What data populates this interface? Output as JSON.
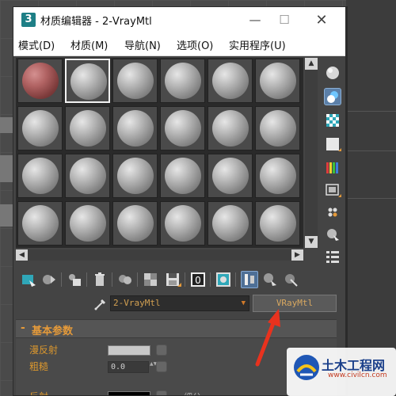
{
  "window": {
    "app_icon_glyph": "3",
    "title": "材质编辑器 - 2-VrayMtl",
    "controls": {
      "minimize": "—",
      "maximize": "☐",
      "close": "✕"
    }
  },
  "menu": [
    "模式(D)",
    "材质(M)",
    "导航(N)",
    "选项(O)",
    "实用程序(U)"
  ],
  "sample_slots": {
    "rows": 4,
    "columns": 6,
    "selected_slot": 2,
    "red_slot": 1
  },
  "scroll_glyphs": {
    "up": "▲",
    "down": "▼",
    "left": "◀",
    "right": "▶"
  },
  "material": {
    "name": "2-VrayMtl",
    "type_button": "VRayMtl"
  },
  "rollout": {
    "collapse_glyph": "-",
    "title": "基本参数",
    "diffuse_label": "漫反射",
    "roughness_label": "粗糙",
    "roughness_value": "0.0",
    "reflect_label": "反射",
    "subdivs_label": "细分",
    "spin_glyphs": "▲▼"
  },
  "watermark": {
    "title": "土木工程网",
    "url": "www.civilcn.com"
  },
  "colors": {
    "accent_orange": "#e59a3a",
    "material_name_text": "#d2a052",
    "arrow_red": "#e8321e",
    "diffuse_swatch": "#c8c8c8",
    "reflect_swatch": "#000000",
    "active_button": "#5b7fa8"
  },
  "icons": {
    "sidebar": [
      "sample-type-sphere-icon",
      "backlight-icon",
      "checker-background-icon",
      "sample-uv-tiling-icon",
      "video-color-check-icon",
      "make-preview-icon",
      "options-icon",
      "select-by-material-icon",
      "material-navigator-icon"
    ],
    "toolbar": [
      "get-material-icon",
      "put-to-scene-icon",
      "assign-to-selection-icon",
      "reset-map-icon",
      "make-copy-icon",
      "make-unique-icon",
      "put-to-library-icon",
      "material-id-channel-icon",
      "show-shaded-map-icon",
      "show-end-result-icon",
      "go-to-parent-icon",
      "go-forward-to-sibling-icon"
    ]
  }
}
